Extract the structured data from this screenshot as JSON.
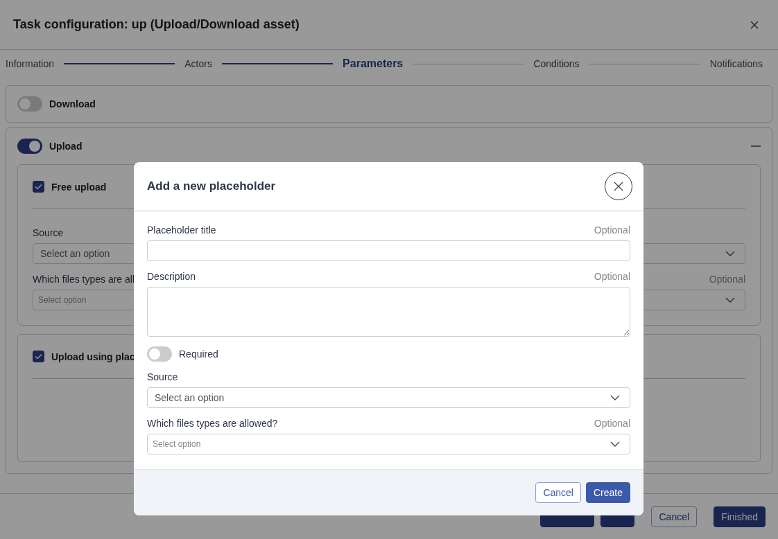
{
  "window": {
    "title": "Task configuration: up (Upload/Download asset)"
  },
  "steps": [
    {
      "label": "Information",
      "selected": false,
      "completed": true
    },
    {
      "label": "Actors",
      "selected": false,
      "completed": true
    },
    {
      "label": "Parameters",
      "selected": true,
      "completed": false
    },
    {
      "label": "Conditions",
      "selected": false,
      "completed": false
    },
    {
      "label": "Notifications",
      "selected": false
    }
  ],
  "sections": [
    {
      "title": "Download",
      "on": false,
      "expanded": false
    },
    {
      "title": "Upload",
      "on": true,
      "expanded": true,
      "options": [
        {
          "label": "Free upload",
          "checked": true,
          "fields": [
            {
              "kind": "select",
              "label": "Source",
              "placeholder": "Select an option"
            },
            {
              "kind": "multiselect",
              "label": "Which files types are all",
              "optional": "Optional",
              "placeholder": "Select option"
            }
          ]
        },
        {
          "label": "Upload using plac",
          "checked": true
        }
      ]
    }
  ],
  "footer_buttons": [
    {
      "kind": "primary"
    },
    {
      "kind": "primary"
    },
    {
      "label": "Cancel",
      "kind": "outline"
    },
    {
      "label": "Finished",
      "kind": "primary"
    }
  ],
  "modal": {
    "title": "Add a new placeholder",
    "fields": [
      {
        "kind": "text",
        "label": "Placeholder title",
        "optional": "Optional"
      },
      {
        "kind": "textarea",
        "label": "Description",
        "optional": "Optional"
      },
      {
        "kind": "toggle",
        "label": "Required",
        "on": false
      },
      {
        "kind": "select",
        "label": "Source",
        "placeholder": "Select an option"
      },
      {
        "kind": "multiselect",
        "label": "Which files types are allowed?",
        "optional": "Optional",
        "placeholder": "Select option"
      }
    ],
    "buttons": [
      {
        "label": "Cancel",
        "kind": "outline"
      },
      {
        "label": "Create",
        "kind": "primary"
      }
    ]
  }
}
